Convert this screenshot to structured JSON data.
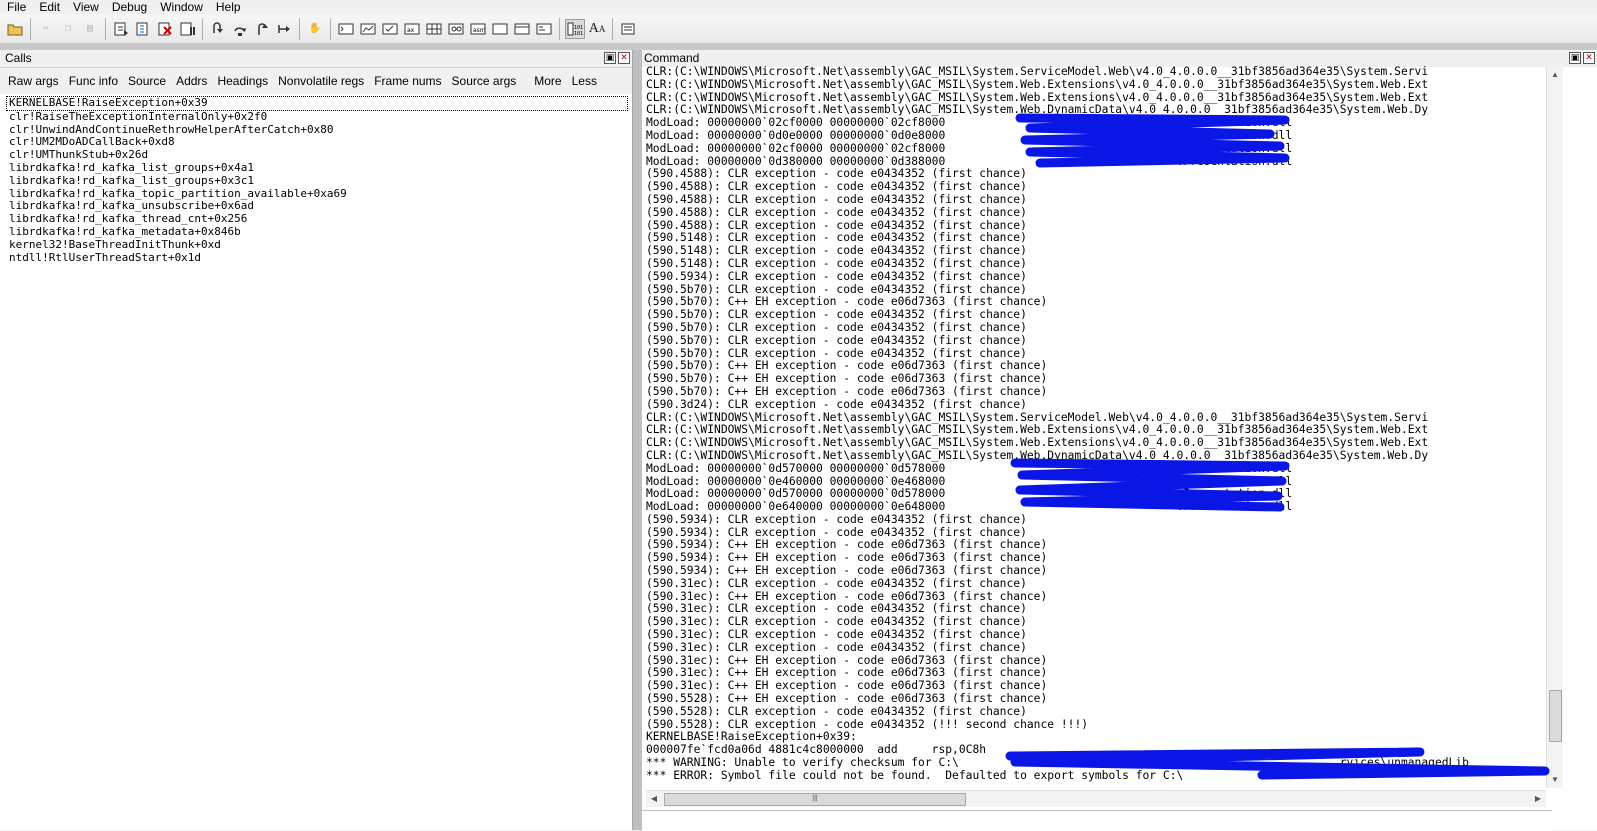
{
  "menu": [
    "File",
    "Edit",
    "View",
    "Debug",
    "Window",
    "Help"
  ],
  "toolbar_icons": [
    "open-icon",
    "cut-icon",
    "copy-icon",
    "paste-icon",
    "go-icon",
    "restart-icon",
    "stop-debugging-icon",
    "break-icon",
    "step-into-icon",
    "step-over-icon",
    "step-out-icon",
    "run-to-cursor-icon",
    "hand-icon",
    "command-window-icon",
    "watch-icon",
    "locals-icon",
    "registers-icon",
    "memory-icon",
    "call-stack-icon",
    "disassembly-icon",
    "scratch-pad-icon",
    "processes-threads-icon",
    "source-mode-icon",
    "font-icon",
    "options-icon"
  ],
  "calls": {
    "title": "Calls",
    "toolbar": [
      "Raw args",
      "Func info",
      "Source",
      "Addrs",
      "Headings",
      "Nonvolatile regs",
      "Frame nums",
      "Source args",
      "More",
      "Less"
    ],
    "frames": [
      "KERNELBASE!RaiseException+0x39",
      "clr!RaiseTheExceptionInternalOnly+0x2f0",
      "clr!UnwindAndContinueRethrowHelperAfterCatch+0x80",
      "clr!UM2MDoADCallBack+0xd8",
      "clr!UMThunkStub+0x26d",
      "librdkafka!rd_kafka_list_groups+0x4a1",
      "librdkafka!rd_kafka_list_groups+0x3c1",
      "librdkafka!rd_kafka_topic_partition_available+0xa69",
      "librdkafka!rd_kafka_unsubscribe+0x6ad",
      "librdkafka!rd_kafka_thread_cnt+0x256",
      "librdkafka!rd_kafka_metadata+0x846b",
      "kernel32!BaseThreadInitThunk+0xd",
      "ntdll!RtlUserThreadStart+0x1d"
    ]
  },
  "command": {
    "title": "Command",
    "lines": [
      "CLR:(C:\\WINDOWS\\Microsoft.Net\\assembly\\GAC_MSIL\\System.ServiceModel.Web\\v4.0_4.0.0.0__31bf3856ad364e35\\System.Servi",
      "CLR:(C:\\WINDOWS\\Microsoft.Net\\assembly\\GAC_MSIL\\System.Web.Extensions\\v4.0_4.0.0.0__31bf3856ad364e35\\System.Web.Ext",
      "CLR:(C:\\WINDOWS\\Microsoft.Net\\assembly\\GAC_MSIL\\System.Web.Extensions\\v4.0_4.0.0.0__31bf3856ad364e35\\System.Web.Ext",
      "CLR:(C:\\WINDOWS\\Microsoft.Net\\assembly\\GAC_MSIL\\System.Web.DynamicData\\v4.0_4.0.0.0__31bf3856ad364e35\\System.Web.Dy",
      "ModLoad: 00000000`02cf0000 00000000`02cf8000                                  .Presentation.dll",
      "ModLoad: 00000000`0d0e0000 00000000`0d0e8000                                  .Presentation.dll",
      "ModLoad: 00000000`02cf0000 00000000`02cf8000                                  .Presentation.dll",
      "ModLoad: 00000000`0d380000 00000000`0d388000                                  .Presentation.dll",
      "(590.4588): CLR exception - code e0434352 (first chance)",
      "(590.4588): CLR exception - code e0434352 (first chance)",
      "(590.4588): CLR exception - code e0434352 (first chance)",
      "(590.4588): CLR exception - code e0434352 (first chance)",
      "(590.4588): CLR exception - code e0434352 (first chance)",
      "(590.5148): CLR exception - code e0434352 (first chance)",
      "(590.5148): CLR exception - code e0434352 (first chance)",
      "(590.5148): CLR exception - code e0434352 (first chance)",
      "(590.5934): CLR exception - code e0434352 (first chance)",
      "(590.5b70): CLR exception - code e0434352 (first chance)",
      "(590.5b70): C++ EH exception - code e06d7363 (first chance)",
      "(590.5b70): CLR exception - code e0434352 (first chance)",
      "(590.5b70): CLR exception - code e0434352 (first chance)",
      "(590.5b70): CLR exception - code e0434352 (first chance)",
      "(590.5b70): CLR exception - code e0434352 (first chance)",
      "(590.5b70): C++ EH exception - code e06d7363 (first chance)",
      "(590.5b70): C++ EH exception - code e06d7363 (first chance)",
      "(590.5b70): C++ EH exception - code e06d7363 (first chance)",
      "(590.3d24): CLR exception - code e0434352 (first chance)",
      "CLR:(C:\\WINDOWS\\Microsoft.Net\\assembly\\GAC_MSIL\\System.ServiceModel.Web\\v4.0_4.0.0.0__31bf3856ad364e35\\System.Servi",
      "CLR:(C:\\WINDOWS\\Microsoft.Net\\assembly\\GAC_MSIL\\System.Web.Extensions\\v4.0_4.0.0.0__31bf3856ad364e35\\System.Web.Ext",
      "CLR:(C:\\WINDOWS\\Microsoft.Net\\assembly\\GAC_MSIL\\System.Web.Extensions\\v4.0_4.0.0.0__31bf3856ad364e35\\System.Web.Ext",
      "CLR:(C:\\WINDOWS\\Microsoft.Net\\assembly\\GAC_MSIL\\System.Web.DynamicData\\v4.0_4.0.0.0__31bf3856ad364e35\\System.Web.Dy",
      "ModLoad: 00000000`0d570000 00000000`0d578000                                  .Presentation.dll",
      "ModLoad: 00000000`0e460000 00000000`0e468000                                  .Presentation.dll",
      "ModLoad: 00000000`0d570000 00000000`0d578000                                  .Presentation.dll",
      "ModLoad: 00000000`0e640000 00000000`0e648000                                  .Presentation.dll",
      "(590.5934): CLR exception - code e0434352 (first chance)",
      "(590.5934): CLR exception - code e0434352 (first chance)",
      "(590.5934): C++ EH exception - code e06d7363 (first chance)",
      "(590.5934): C++ EH exception - code e06d7363 (first chance)",
      "(590.5934): C++ EH exception - code e06d7363 (first chance)",
      "(590.31ec): CLR exception - code e0434352 (first chance)",
      "(590.31ec): C++ EH exception - code e06d7363 (first chance)",
      "(590.31ec): CLR exception - code e0434352 (first chance)",
      "(590.31ec): CLR exception - code e0434352 (first chance)",
      "(590.31ec): CLR exception - code e0434352 (first chance)",
      "(590.31ec): CLR exception - code e0434352 (first chance)",
      "(590.31ec): C++ EH exception - code e06d7363 (first chance)",
      "(590.31ec): C++ EH exception - code e06d7363 (first chance)",
      "(590.31ec): C++ EH exception - code e06d7363 (first chance)",
      "(590.5528): C++ EH exception - code e06d7363 (first chance)",
      "(590.5528): CLR exception - code e0434352 (first chance)",
      "(590.5528): CLR exception - code e0434352 (!!! second chance !!!)",
      "KERNELBASE!RaiseException+0x39:",
      "000007fe`fcd0a06d 4881c4c8000000  add     rsp,0C8h",
      "*** WARNING: Unable to verify checksum for C:\\                                                        rvices\\unmanagedLib",
      "*** ERROR: Symbol file could not be found.  Defaulted to export symbols for C:\\"
    ],
    "hscroll_grip": "|||"
  },
  "colors": {
    "redaction": "#0a16e6",
    "menu_bg": "#f0f0f0",
    "splitter": "#bfbfbf"
  }
}
